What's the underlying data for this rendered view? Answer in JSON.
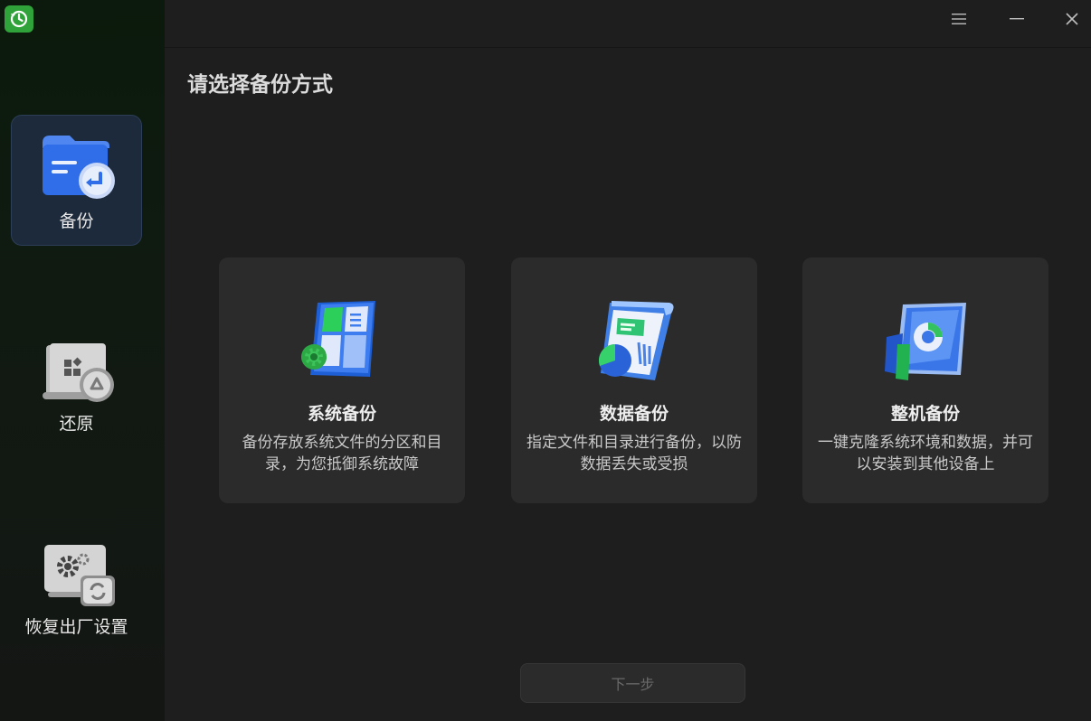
{
  "app": {
    "logo_icon": "history-clock-icon",
    "accent": "#2fa33a"
  },
  "sidebar": {
    "items": [
      {
        "label": "备份",
        "icon": "folder-backup-icon",
        "active": true
      },
      {
        "label": "还原",
        "icon": "restore-recycle-icon",
        "active": false
      },
      {
        "label": "恢复出厂设置",
        "icon": "factory-reset-gear-icon",
        "active": false
      }
    ]
  },
  "window_controls": {
    "menu_icon": "menu-icon",
    "minimize_icon": "minimize-icon",
    "close_icon": "close-icon"
  },
  "main": {
    "title": "请选择备份方式",
    "cards": [
      {
        "title": "系统备份",
        "description": "备份存放系统文件的分区和目录，为您抵御系统故障",
        "icon": "system-backup-icon"
      },
      {
        "title": "数据备份",
        "description": "指定文件和目录进行备份，以防数据丢失或受损",
        "icon": "data-backup-icon"
      },
      {
        "title": "整机备份",
        "description": "一键克隆系统环境和数据，并可以安装到其他设备上",
        "icon": "full-machine-backup-icon"
      }
    ],
    "next_button": "下一步"
  }
}
